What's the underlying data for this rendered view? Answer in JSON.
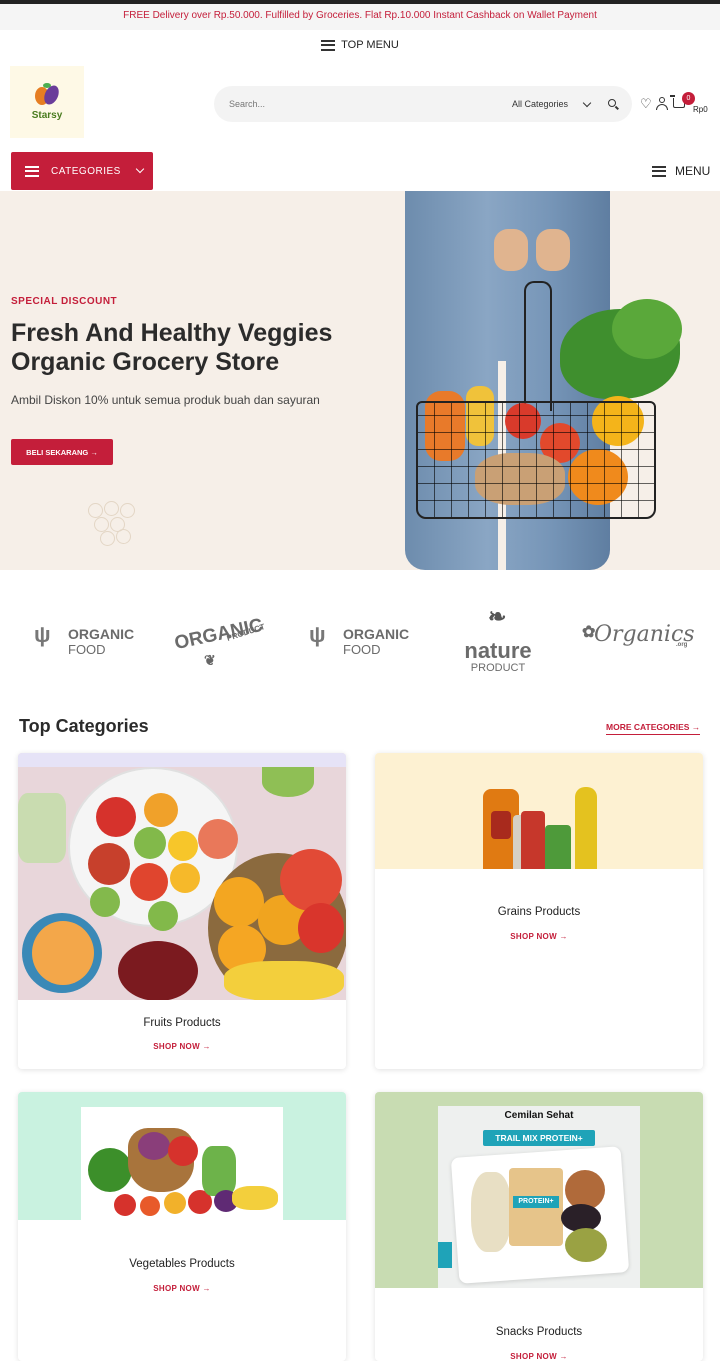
{
  "promo": {
    "text": "FREE Delivery over Rp.50.000. Fulfilled by Groceries. Flat Rp.10.000 Instant Cashback on Wallet Payment"
  },
  "top_menu": {
    "label": "TOP MENU"
  },
  "logo": {
    "text": "Starsy"
  },
  "search": {
    "placeholder": "Search...",
    "category": "All Categories"
  },
  "header_icons": {
    "cart_count": "0",
    "cart_total": "Rp0"
  },
  "nav": {
    "categories_label": "CATEGORIES",
    "menu_label": "MENU"
  },
  "hero": {
    "kicker": "SPECIAL DISCOUNT",
    "title": "Fresh And Healthy Veggies Organic Grocery Store",
    "subtitle": "Ambil Diskon 10% untuk semua produk buah dan sayuran",
    "button": "BELI SEKARANG →"
  },
  "brands": [
    {
      "name": "ORGANIC",
      "sub": "FOOD"
    },
    {
      "name": "ORGANIC",
      "sub": "PRODUCT"
    },
    {
      "name": "ORGANIC",
      "sub": "FOOD"
    },
    {
      "name": "nature",
      "sub": "PRODUCT"
    },
    {
      "name": "Organics",
      "sub": ".org"
    }
  ],
  "top_categories": {
    "title": "Top Categories",
    "more_link": "MORE CATEGORIES →",
    "cards": [
      {
        "title": "Fruits Products",
        "link": "SHOP NOW →"
      },
      {
        "title": "Grains Products",
        "link": "SHOP NOW →"
      },
      {
        "title": "Vegetables Products",
        "link": "SHOP NOW →"
      },
      {
        "title": "Snacks Products",
        "link": "SHOP NOW →"
      }
    ]
  },
  "snacks_image": {
    "heading": "Cemilan Sehat",
    "banner": "TRAIL MIX PROTEIN+",
    "pack_label": "PROTEIN+"
  },
  "colors": {
    "accent": "#c41e3a",
    "hero_bg": "#f6efe8",
    "grains_bg": "#fdf1d2",
    "veg_bg": "#c9f2e0",
    "snacks_bg": "#c8dcb2"
  }
}
